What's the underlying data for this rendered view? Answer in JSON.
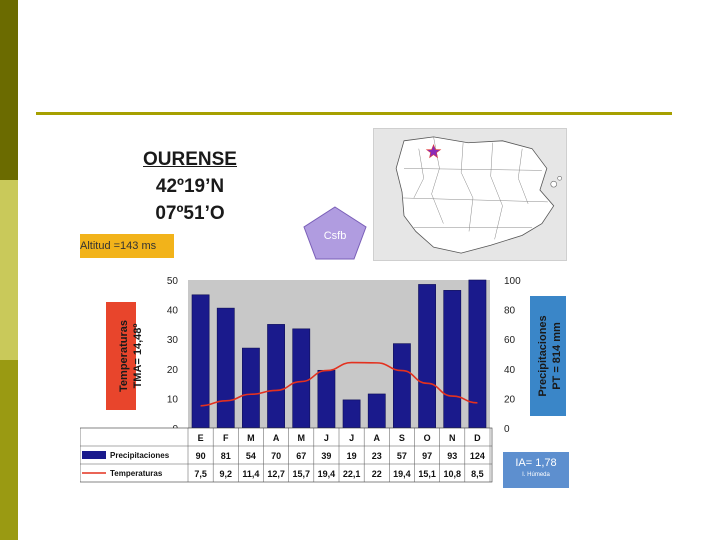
{
  "station": {
    "name": "OURENSE",
    "latitude": "42º19’N",
    "longitude": "07º51’O",
    "altitude_label": "Altitud =143 ms",
    "koppen": "Csfb"
  },
  "summary": {
    "temp_label_1": "Temperaturas",
    "temp_label_2": "TMA= 14,48º",
    "prec_label_1": "Precipitaciones",
    "prec_label_2": "PT = 814 mm",
    "ia_value": "IA= 1,78",
    "ia_class": "I. Húmeda"
  },
  "colors": {
    "side_bar_dark": "#6b6b00",
    "side_bar_light": "#c9c95a",
    "rule": "#a6a000",
    "bars": "#1a1a8c",
    "temp_line": "#e3311f",
    "temp_box": "#e8452c",
    "prec_box": "#3a86c8",
    "plot_bg": "#c8c8c8"
  },
  "chart_data": {
    "type": "bar",
    "categories": [
      "E",
      "F",
      "M",
      "A",
      "M",
      "J",
      "J",
      "A",
      "S",
      "O",
      "N",
      "D"
    ],
    "series": [
      {
        "name": "Precipitaciones",
        "type": "bar",
        "axis": "right",
        "values": [
          90,
          81,
          54,
          70,
          67,
          39,
          19,
          23,
          57,
          97,
          93,
          124
        ]
      },
      {
        "name": "Temperaturas",
        "type": "line",
        "axis": "left",
        "values": [
          7.5,
          9.2,
          11.4,
          12.7,
          15.7,
          19.4,
          22.1,
          22,
          19.4,
          15.1,
          10.8,
          8.5
        ]
      }
    ],
    "table_values": {
      "Precipitaciones": [
        "90",
        "81",
        "54",
        "70",
        "67",
        "39",
        "19",
        "23",
        "57",
        "97",
        "93",
        "124"
      ],
      "Temperaturas": [
        "7,5",
        "9,2",
        "11,4",
        "12,7",
        "15,7",
        "19,4",
        "22,1",
        "22",
        "19,4",
        "15,1",
        "10,8",
        "8,5"
      ]
    },
    "left_axis": {
      "ylim": [
        0,
        50
      ],
      "ticks": [
        "0",
        "10",
        "20",
        "30",
        "40",
        "50"
      ]
    },
    "right_axis": {
      "ylim": [
        0,
        100
      ],
      "ticks": [
        "0",
        "20",
        "40",
        "60",
        "80",
        "100"
      ]
    },
    "grid": false
  }
}
